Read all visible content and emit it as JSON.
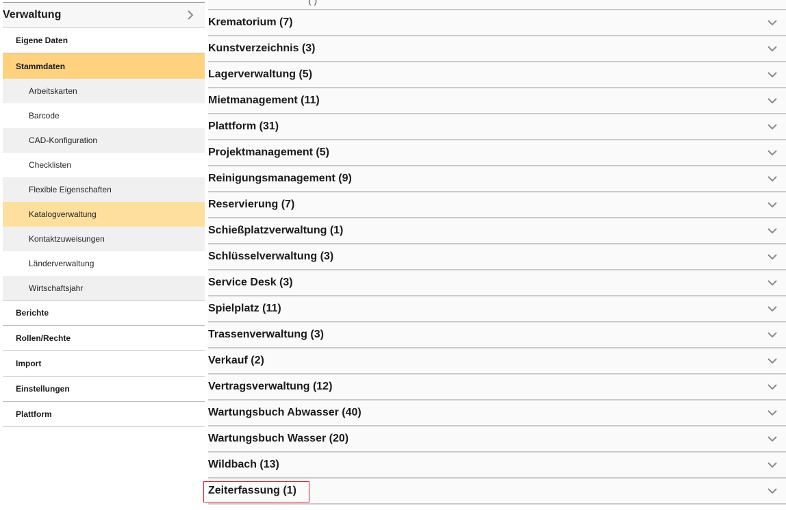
{
  "sidebar": {
    "title": "Verwaltung",
    "items_top": [
      {
        "label": "Eigene Daten"
      },
      {
        "label": "Stammdaten"
      }
    ],
    "subitems": [
      {
        "label": "Arbeitskarten"
      },
      {
        "label": "Barcode"
      },
      {
        "label": "CAD-Konfiguration"
      },
      {
        "label": "Checklisten"
      },
      {
        "label": "Flexible Eigenschaften"
      },
      {
        "label": "Katalogverwaltung"
      },
      {
        "label": "Kontaktzuweisungen"
      },
      {
        "label": "Länderverwaltung"
      },
      {
        "label": "Wirtschaftsjahr"
      }
    ],
    "items_bottom": [
      {
        "label": "Berichte"
      },
      {
        "label": "Rollen/Rechte"
      },
      {
        "label": "Import"
      },
      {
        "label": "Einstellungen"
      },
      {
        "label": "Plattform"
      }
    ]
  },
  "main": {
    "top_partial": "( )",
    "rows": [
      {
        "label": "Krematorium (7)"
      },
      {
        "label": "Kunstverzeichnis (3)"
      },
      {
        "label": "Lagerverwaltung (5)"
      },
      {
        "label": "Mietmanagement (11)"
      },
      {
        "label": "Plattform (31)"
      },
      {
        "label": "Projektmanagement (5)"
      },
      {
        "label": "Reinigungsmanagement (9)"
      },
      {
        "label": "Reservierung (7)"
      },
      {
        "label": "Schießplatzverwaltung (1)"
      },
      {
        "label": "Schlüsselverwaltung (3)"
      },
      {
        "label": "Service Desk (3)"
      },
      {
        "label": "Spielplatz (11)"
      },
      {
        "label": "Trassenverwaltung (3)"
      },
      {
        "label": "Verkauf (2)"
      },
      {
        "label": "Vertragsverwaltung (12)"
      },
      {
        "label": "Wartungsbuch Abwasser (40)"
      },
      {
        "label": "Wartungsbuch Wasser (20)"
      },
      {
        "label": "Wildbach (13)"
      },
      {
        "label": "Zeiterfassung (1)"
      }
    ]
  },
  "colors": {
    "active_item": "#ffd280",
    "selected_subitem": "#ffdf9e",
    "highlight_border": "#e0202a"
  },
  "icons": {
    "sidebar_header": "chevron-right-icon",
    "row_toggle": "chevron-down-icon"
  }
}
